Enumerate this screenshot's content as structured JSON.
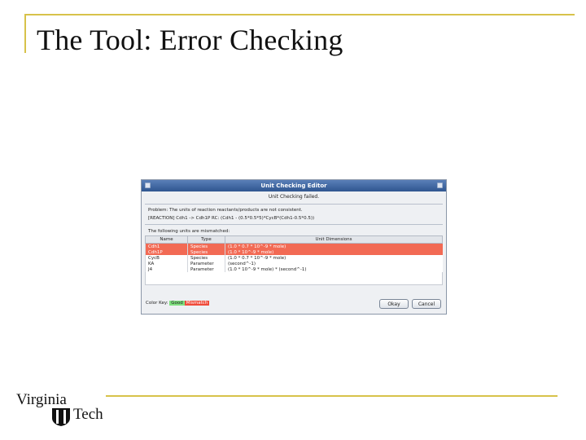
{
  "slide": {
    "title": "The Tool: Error Checking"
  },
  "dialog": {
    "title": "Unit Checking Editor",
    "status": "Unit Checking failed.",
    "problem_line1": "Problem:  The units of reaction reactants/products are not consistent.",
    "problem_line2": "[REACTION] Cdh1 -> Cdh1P    RC: (Cdh1 - (0.5*0.5*5)*CycB*(Cdh1-0.5*0.5))",
    "sub_label": "The following units are mismatched:",
    "columns": [
      "Name",
      "Type",
      "Unit Dimensions"
    ],
    "rows": [
      {
        "name": "Cdh1",
        "type": "Species",
        "units": "(1.0 * 0.7 * 10^-9 * mole)",
        "status": "error"
      },
      {
        "name": "Cdh1P",
        "type": "Species",
        "units": "(1.0 * 10^-9 * mole)",
        "status": "error"
      },
      {
        "name": "CycB",
        "type": "Species",
        "units": "(1.0 * 0.7 * 10^-9 * mole)",
        "status": "ok"
      },
      {
        "name": "KA",
        "type": "Parameter",
        "units": "(second^-1)",
        "status": "ok"
      },
      {
        "name": "J4",
        "type": "Parameter",
        "units": "(1.0 * 10^-9 * mole) * (second^-1)",
        "status": "ok"
      }
    ],
    "legend_label": "Color Key:",
    "legend_good": "Good",
    "legend_bad": "Mismatch",
    "okay_label": "Okay",
    "cancel_label": "Cancel"
  },
  "logo": {
    "line1": "Virginia",
    "line2": "Tech"
  },
  "colors": {
    "accent_rule": "#d7c24a",
    "error_row": "#f26a54",
    "titlebar": "#2f5690"
  }
}
